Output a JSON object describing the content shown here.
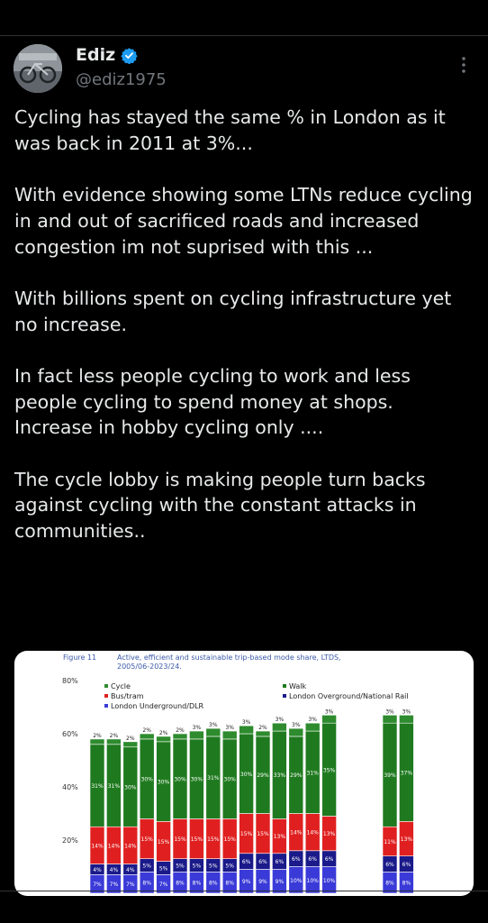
{
  "author": {
    "name": "Ediz",
    "handle": "@ediz1975"
  },
  "icons": {
    "verified": "verified-badge-icon",
    "more": "more-options-icon"
  },
  "colors": {
    "background": "#000000",
    "text": "#e7e9ea",
    "secondary": "#71767b",
    "verified": "#1d9bf0"
  },
  "tweet": {
    "paragraphs": [
      "Cycling has stayed the same % in London as it was back in 2011 at 3%...",
      "With evidence showing some LTNs reduce cycling in and out of sacrificed roads and increased congestion im not suprised with this ...",
      "With billions spent on cycling infrastructure yet no increase.",
      "In fact less people cycling to work and less people cycling to spend money at shops. Increase in hobby cycling only ....",
      "The cycle lobby is making people turn backs against cycling with the constant attacks in communities.."
    ]
  },
  "chart_data": {
    "type": "bar",
    "stacked": true,
    "figure_label": "Figure 11",
    "title": "Active, efficient and sustainable trip-based mode share, LTDS,",
    "subtitle": "2005/06-2023/24.",
    "y_ticks": [
      "80%",
      "60%",
      "40%",
      "20%"
    ],
    "ylim": [
      0,
      80
    ],
    "legend": [
      {
        "name": "Cycle",
        "color": "#2e8b2e"
      },
      {
        "name": "Walk",
        "color": "#1f7a1f"
      },
      {
        "name": "Bus/tram",
        "color": "#e02020"
      },
      {
        "name": "London Overground/National Rail",
        "color": "#1a1a8a"
      },
      {
        "name": "London Underground/DLR",
        "color": "#3a3ad8"
      }
    ],
    "bar_groups": [
      {
        "bars": [
          {
            "rail": 7,
            "bus": 14,
            "walk": 31,
            "cycle": 2,
            "labels": {
              "rail": "7%",
              "bus": "14%",
              "walk": "31%",
              "cycle": "2%"
            }
          },
          {
            "rail": 7,
            "bus": 14,
            "walk": 31,
            "cycle": 2,
            "labels": {
              "rail": "7%",
              "bus": "14%",
              "walk": "31%",
              "cycle": "2%"
            }
          },
          {
            "rail": 7,
            "bus": 14,
            "walk": 30,
            "cycle": 2,
            "labels": {
              "rail": "7%",
              "bus": "14%",
              "walk": "30%",
              "cycle": "2%"
            }
          },
          {
            "rail": 8,
            "bus": 15,
            "walk": 30,
            "cycle": 2,
            "labels": {
              "rail": "8%",
              "bus": "15%",
              "walk": "30%",
              "cycle": "2%"
            }
          },
          {
            "rail": 7,
            "bus": 15,
            "walk": 30,
            "cycle": 2,
            "labels": {
              "rail": "7%",
              "bus": "15%",
              "walk": "30%",
              "cycle": "2%"
            }
          },
          {
            "rail": 8,
            "bus": 15,
            "walk": 30,
            "cycle": 2,
            "labels": {
              "rail": "8%",
              "bus": "15%",
              "walk": "30%",
              "cycle": "2%"
            }
          },
          {
            "rail": 8,
            "bus": 15,
            "walk": 30,
            "cycle": 3,
            "labels": {
              "rail": "8%",
              "bus": "15%",
              "walk": "30%",
              "cycle": "3%"
            }
          },
          {
            "rail": 8,
            "bus": 15,
            "walk": 31,
            "cycle": 3,
            "labels": {
              "rail": "8%",
              "bus": "15%",
              "walk": "31%",
              "cycle": "3%"
            }
          },
          {
            "rail": 8,
            "bus": 15,
            "walk": 30,
            "cycle": 3,
            "labels": {
              "rail": "8%",
              "bus": "15%",
              "walk": "30%",
              "cycle": "3%"
            }
          },
          {
            "rail": 9,
            "bus": 15,
            "walk": 30,
            "cycle": 3,
            "labels": {
              "rail": "9%",
              "bus": "15%",
              "walk": "30%",
              "cycle": "3%"
            }
          },
          {
            "rail": 9,
            "bus": 15,
            "walk": 29,
            "cycle": 2,
            "labels": {
              "rail": "9%",
              "bus": "15%",
              "walk": "29%",
              "cycle": "2%"
            }
          },
          {
            "rail": 9,
            "bus": 13,
            "walk": 33,
            "cycle": 3,
            "labels": {
              "rail": "9%",
              "bus": "13%",
              "walk": "33%",
              "cycle": "3%"
            }
          },
          {
            "rail": 10,
            "bus": 14,
            "walk": 29,
            "cycle": 3,
            "labels": {
              "rail": "10%",
              "bus": "14%",
              "walk": "29%",
              "cycle": "3%"
            }
          },
          {
            "rail": 10,
            "bus": 14,
            "walk": 31,
            "cycle": 3,
            "labels": {
              "rail": "10%",
              "bus": "14%",
              "walk": "31%",
              "cycle": "3%"
            }
          },
          {
            "rail": 10,
            "bus": 13,
            "walk": 35,
            "cycle": 3,
            "labels": {
              "rail": "10%",
              "bus": "13%",
              "walk": "35%",
              "cycle": "3%"
            }
          }
        ]
      },
      {
        "bars": [
          {
            "rail": 8,
            "bus": 11,
            "walk": 39,
            "cycle": 3,
            "labels": {
              "rail": "8%",
              "bus": "11%",
              "walk": "39%",
              "cycle": "3%"
            }
          },
          {
            "rail": 8,
            "bus": 13,
            "walk": 37,
            "cycle": 3,
            "labels": {
              "rail": "8%",
              "bus": "13%",
              "walk": "37%",
              "cycle": "3%"
            }
          }
        ]
      }
    ],
    "overground_labels_group1": [
      "4%",
      "4%",
      "4%",
      "5%",
      "5%",
      "5%",
      "5%",
      "5%",
      "5%",
      "6%",
      "6%",
      "6%",
      "6%",
      "6%",
      "6%"
    ],
    "overground_labels_group2": [
      "6%",
      "6%"
    ]
  }
}
